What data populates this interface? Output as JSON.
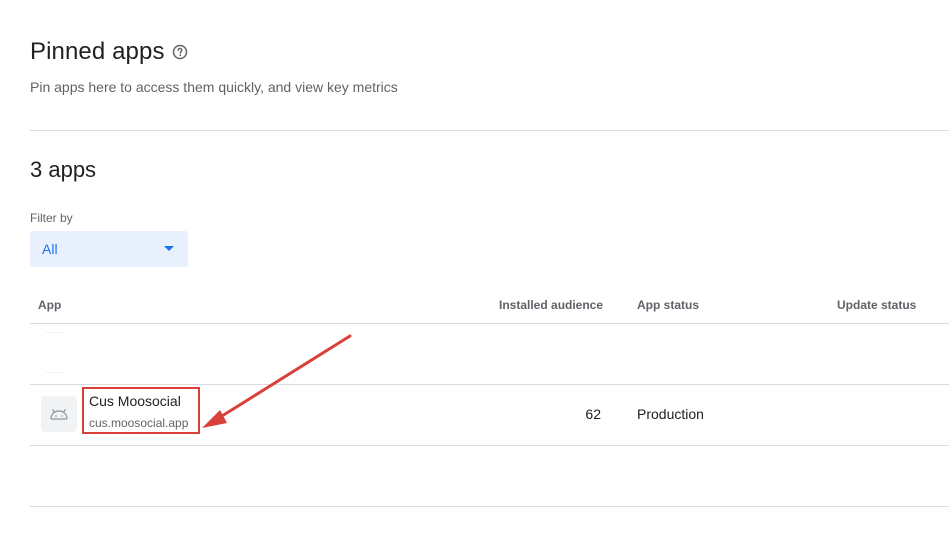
{
  "header": {
    "title": "Pinned apps",
    "subtitle": "Pin apps here to access them quickly, and view key metrics"
  },
  "apps_section": {
    "count_heading": "3 apps",
    "filter": {
      "label": "Filter by",
      "selected": "All"
    },
    "table": {
      "columns": [
        "App",
        "Installed audience",
        "App status",
        "Update status"
      ],
      "rows": [
        {
          "name": "Cus Moosocial",
          "package": "cus.moosocial.app",
          "installed_audience": "62",
          "app_status": "Production",
          "update_status": ""
        }
      ]
    }
  },
  "colors": {
    "accent": "#1a73e8",
    "annotation": "#d9403a",
    "divider": "#dadce0",
    "muted_text": "#5f6368"
  },
  "icons": [
    "help-circle-icon",
    "dropdown-caret-icon",
    "android-icon"
  ]
}
